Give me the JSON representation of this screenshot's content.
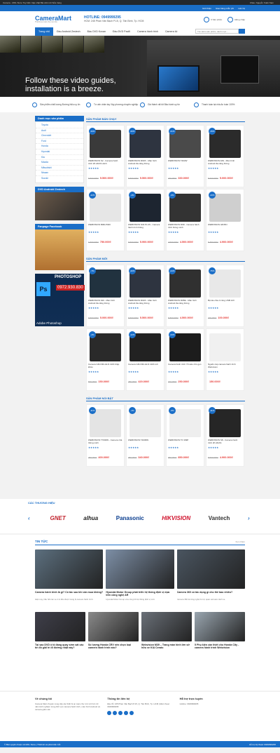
{
  "wpbar": {
    "left": "Camera - MOL Store   Tùy biến   Cập nhật   Bài viết mới   Sửa trang",
    "right": "Chào, Nguyễn Xuân Nam"
  },
  "topbar": {
    "items": [
      "Giới thiệu",
      "Giao hàng miễn phí",
      "Liên hệ"
    ]
  },
  "header": {
    "logo": "CameraMart",
    "tagline": "Thiết bị an toàn cho mọi nhà",
    "hotline_label": "HOTLINE: 0949999295",
    "address": "HCM: 245 Phan Văn Bạch P.15, Q. Tân Bình, Tp. HCM",
    "cart": "0 Sản phẩm",
    "login": "Đăng nhập"
  },
  "nav": {
    "items": [
      "Trang chủ",
      "Đầu Android Zestech",
      "Đầu DVD Kovan",
      "Đầu DVD Pacifi",
      "Camera hành trình",
      "Camera lùi"
    ],
    "search_placeholder": "Tìm kiếm sản phẩm, danh mục..."
  },
  "hero": {
    "text_line1": "Follow these video guides,",
    "text_line2": "installation is a breeze."
  },
  "features": [
    "Sản phẩm chất lượng Đường hiệu uy tín",
    "Tư vấn chân tay Vậy phương chuyên nghiệp",
    "Giá thành rất tốt Bảo hành uy tín",
    "Thanh toán tại nhà An toàn 100%"
  ],
  "sidebar": {
    "cat_title": "Danh mục sản phẩm",
    "cats": [
      "Toyota",
      "Audi",
      "Chevrolet",
      "Ford",
      "Honda",
      "Hyundai",
      "Kia",
      "Mazda",
      "Mitsubishi",
      "Nissan",
      "Suzuki"
    ],
    "box1_title": "DVD Android Zestech",
    "box2_title": "Fanpage Facebook",
    "ps_title": "PHOTOSHOP",
    "ps_num": "0972.930.830",
    "ps_caption": "Adobe Photoshop"
  },
  "sections": [
    {
      "title": "SẢN PHẨM BÁN CHẠY",
      "products": [
        {
          "badge": "-16%",
          "name": "WEBVISION S2 - Camera hành trình 2K ADAS cảnh",
          "old": "6.500.000₫",
          "price": "5.500.000₫",
          "img": "#3a3a3a"
        },
        {
          "badge": "-20%",
          "name": "WEBVISION M33X - Màn hình Android đa năng thông",
          "old": "6.500.000₫",
          "price": "5.500.000₫",
          "img": "#2e3440"
        },
        {
          "badge": "-21%",
          "name": "WEBVISION T402W",
          "old": "420.000₫",
          "price": "330.000₫",
          "img": "#4a4a4a"
        },
        {
          "badge": "-15%",
          "name": "WEBVISION A69 - Màn hình Android đa năng thông",
          "old": "5.600.000₫",
          "price": "5.000.000₫",
          "img": "#2b2b2b"
        },
        {
          "badge": "-42%",
          "name": "WEBVISION B06LP400",
          "old": "1.500.000₫",
          "price": "750.000₫",
          "img": "#e6e6e6"
        },
        {
          "badge": "-4%",
          "name": "WEBVISION N33 PLUS - Camera hành trình thông",
          "old": "6.500.000₫",
          "price": "5.900.000₫",
          "img": "#1d2530"
        },
        {
          "badge": "-6%",
          "name": "WEBVISION M39 - Camera hành trình thông minh",
          "old": "4.500.000₫",
          "price": "4.500.000₫",
          "img": "#333333"
        },
        {
          "badge": "-20%",
          "name": "WEBVISION 4ZO5N",
          "old": "5.750.000₫",
          "price": "4.900.000₫",
          "img": "#cfcfcf"
        }
      ]
    },
    {
      "title": "SẢN PHẨM MỚI",
      "products": [
        {
          "badge": "-7%",
          "name": "WEBVISION 640 - Màn hình Android đa năng thông",
          "old": "6.500.000₫",
          "price": "5.000.000₫",
          "img": "#21323f"
        },
        {
          "badge": "-20%",
          "name": "WEBVISION M33X - Màn hình Android đa năng thông",
          "old": "6.500.000₫",
          "price": "5.500.000₫",
          "img": "#2e3440"
        },
        {
          "badge": "-24%",
          "name": "WEBVISION M35E - Màn hình Android đa năng thông",
          "old": "5.800.000₫",
          "price": "4.500.000₫",
          "img": "#303030"
        },
        {
          "badge": "-75%",
          "name": "Bộ tẩu chia 3 cổng USB 12V",
          "old": "400.000₫",
          "price": "100.000₫",
          "img": "#e8e8e8"
        },
        {
          "badge": "-2%",
          "name": "Camera GM-N3G ELN 12M nhập khẩu",
          "old": "500.000₫",
          "price": "150.000₫",
          "img": "#2a2a2a"
        },
        {
          "badge": "-12%",
          "name": "Camera GM-N3G ELN 12M mới",
          "old": "480.000₫",
          "price": "420.000₫",
          "img": "#222222"
        },
        {
          "badge": "-23%",
          "name": "Camera hành trình Y9 siêu nhỏ gọn",
          "old": "310.000₫",
          "price": "250.000₫",
          "img": "#1c1c1c"
        },
        {
          "badge": "",
          "name": "Nguồn cáp camera hành trình Webvision",
          "old": "",
          "price": "150.000₫",
          "img": "#f0f0f0"
        }
      ]
    },
    {
      "title": "SẢN PHẨM NỔI BẬT",
      "products": [
        {
          "badge": "-11%",
          "name": "WEBVISION T7000W - Camera nhà thông minh",
          "old": "450.000₫",
          "price": "400.000₫",
          "img": "#e4e4e4"
        },
        {
          "badge": "-1%",
          "name": "WEBVISION T4006W",
          "old": "350.000₫",
          "price": "340.000₫",
          "img": "#ececec"
        },
        {
          "badge": "-6%",
          "name": "WEBVISION TF 309P",
          "old": "950.000₫",
          "price": "850.000₫",
          "img": "#eeeeee"
        },
        {
          "badge": "-11%",
          "name": "WEBVISION S8 - Camera hành trình 2K ADAS",
          "old": "5.500.000₫",
          "price": "4.900.000₫",
          "img": "#262626"
        }
      ]
    }
  ],
  "brands": {
    "title": "CÁC THƯƠNG HIỆU",
    "items": [
      "GNET",
      "alhua",
      "Panasonic",
      "HIKVISION",
      "Vantech"
    ]
  },
  "news": {
    "title": "TIN TỨC",
    "more": "Xem thêm",
    "row1": [
      {
        "title": "Camera hành trình là gì? Có tác sao khi cần mua không?",
        "desc": "Hiện nay, hầu hết các xe ô tô đều được trang bị camera hành trình.",
        "img": "#5c6f7e"
      },
      {
        "title": "Hyundai Motor Group phát triển hệ thống định vị dựa trên công nghệ AR",
        "desc": "Hyundai Motor Group vừa công bố hệ thống định vị mới.",
        "img": "#7d8fa6"
      },
      {
        "title": "Camera 360 có tác dụng gì cho thế bao nhiêu?",
        "desc": "Camera 360 là công nghệ hỗ trợ quan sát toàn cảnh xe.",
        "img": "#4a5560"
      }
    ],
    "row2": [
      {
        "title": "Tại sao DVD ô tô đang quay sớm sát các tín đồ giải trí đi đường nhật này?",
        "img": "#3f3f4a"
      },
      {
        "title": "Số lượng Honda CRV nên chọn loại camera hành trình nào?",
        "img": "#8a8a8a"
      },
      {
        "title": "Webvision M39 – Trang màn hình lớn sở hữu xe KIA Cerato",
        "img": "#6a7078"
      },
      {
        "title": "5 Phụ kiện cần thiết cho Honda City - camera hành trình Webvision",
        "img": "#9aa6b0"
      }
    ]
  },
  "footer": {
    "col1_title": "Về chúng tôi",
    "col1_text": "Camera Mart chuyên cung cấp các thiết bị an toàn cho ô tô với hơn 10 năm kinh nghiệm trong lĩnh vực camera hành trình, màn hình Android và camera giám sát.",
    "col2_title": "Thông tin liên hệ",
    "col2_text": "Địa chỉ: 245 Phan Văn Bạch P.15, Q. Tân Bình, Tp. HCM  |  Điện thoại: 0949999295",
    "col3_title": "Hỗ trợ trực tuyến",
    "col3_text": "Hotline: 0949999295"
  },
  "copyright": {
    "left": "© Bản quyền thuộc về MOL Store | Thiết kế và phát triển bởi",
    "right": "Hỗ trợ kỹ thuật: 0949999295"
  }
}
